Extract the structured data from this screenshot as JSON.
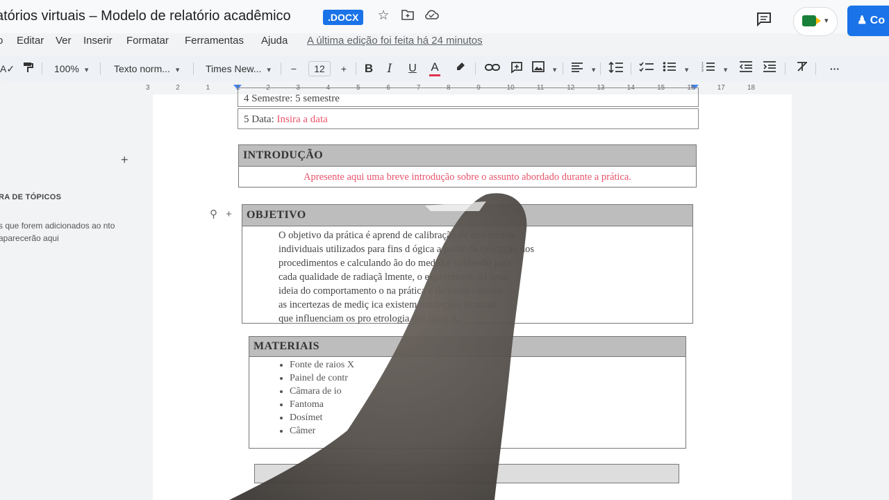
{
  "header": {
    "doc_title": "atórios virtuais – Modelo de relatório acadêmico",
    "format_badge": ".DOCX",
    "share_label": "Co"
  },
  "menu": {
    "items": [
      "o",
      "Editar",
      "Ver",
      "Inserir",
      "Formatar",
      "Ferramentas",
      "Ajuda"
    ],
    "last_edit": "A última edição foi feita há 24 minutos"
  },
  "toolbar": {
    "zoom": "100%",
    "style": "Texto norm...",
    "font": "Times New...",
    "font_size": "12",
    "decrease": "−",
    "increase": "+",
    "bold": "B",
    "italic": "I",
    "underline": "U",
    "text_color": "A"
  },
  "ruler": {
    "ticks": [
      "3",
      "2",
      "1",
      "1",
      "2",
      "3",
      "4",
      "5",
      "6",
      "7",
      "8",
      "9",
      "10",
      "11",
      "12",
      "13",
      "14",
      "15",
      "16",
      "17",
      "18"
    ]
  },
  "outline": {
    "plus": "+",
    "heading": "RA DE TÓPICOS",
    "help": "s que forem adicionados ao nto aparecerão aqui"
  },
  "document": {
    "row_semester": "4  Semestre:  5  semestre",
    "row_date_label": "5  Data:",
    "row_date_value": "Insira a data",
    "intro_heading": "INTRODUÇÃO",
    "intro_text": "Apresente aqui uma breve introdução sobre o assunto abordado durante a prática.",
    "objective_heading": "OBJETIVO",
    "objective_lines": [
      "O objetivo da prática é aprend          de calibração de dosímetros",
      "individuais utilizados para fins d          ógica a partir da execução dos",
      "procedimentos e calculando          ão do medidor calibrado para",
      "cada qualidade de radiaçã          lmente, o experimento dá uma",
      "ideia do comportamento          o na prática e de como calcular",
      "as incertezas de mediç          ica existem limitações técnicas",
      "que influenciam os pro          etrologia dos raios X."
    ],
    "materials_heading": "MATERIAIS",
    "materials": [
      "Fonte de raios X",
      "Painel de contr",
      "Câmara de io",
      "Fantoma",
      "Dosímet",
      "Câmer"
    ]
  },
  "colors": {
    "accent": "#1a73e8",
    "placeholder_text": "#e8536a",
    "section_header": "#bdbdbd"
  },
  "icons": [
    "star-icon",
    "move-to-folder-icon",
    "cloud-status-icon",
    "comment-icon",
    "meet-icon",
    "spellcheck-icon",
    "paint-format-icon",
    "highlight-icon",
    "link-icon",
    "add-comment-icon",
    "image-icon",
    "align-icon",
    "line-spacing-icon",
    "checklist-icon",
    "bullet-list-icon",
    "numbered-list-icon",
    "decrease-indent-icon",
    "increase-indent-icon",
    "clear-format-icon",
    "more-icon"
  ]
}
